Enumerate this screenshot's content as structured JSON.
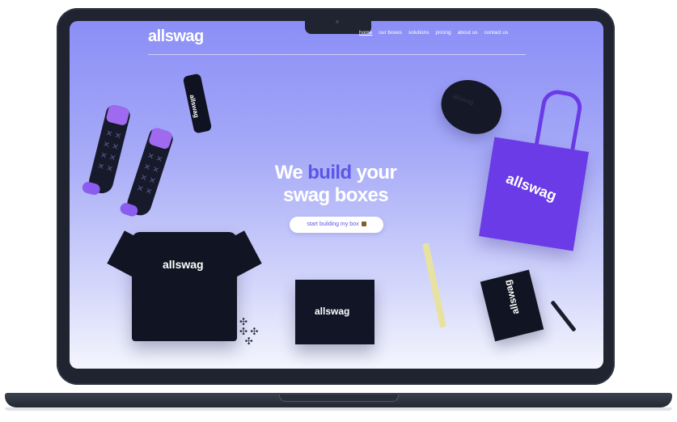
{
  "site": {
    "logo": "allswag",
    "nav": [
      "home",
      "our boxes",
      "solutions",
      "pricing",
      "about us",
      "contact us"
    ],
    "active_nav": "home"
  },
  "hero": {
    "line1_a": "We",
    "line1_b": "build",
    "line1_c": "your",
    "line2": "swag boxes",
    "cta_label": "start building my box"
  },
  "products": {
    "bottle_label": "allswag",
    "cap_label": "allswag",
    "tote_label": "allswag",
    "tshirt_label": "allswag",
    "box_label": "allswag",
    "notebook_label": "allswag"
  },
  "colors": {
    "accent": "#5b56e6",
    "tote": "#6a3be6",
    "bezel": "#1f2430"
  }
}
